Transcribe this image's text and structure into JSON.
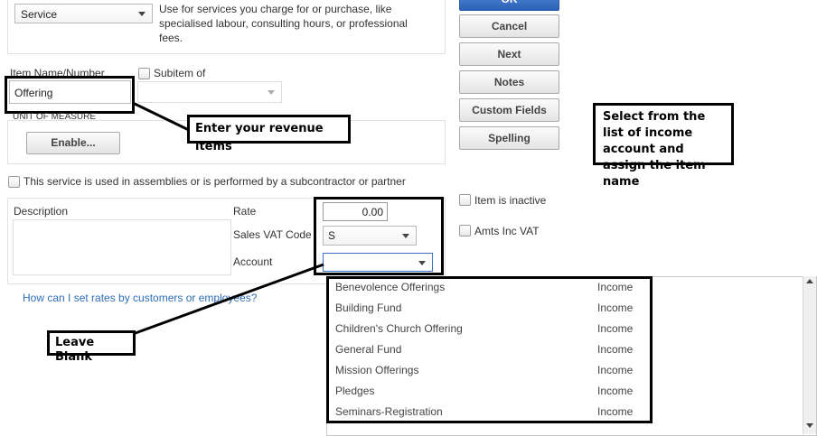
{
  "type": {
    "selected": "Service",
    "description": "Use for services you charge for or purchase, like specialised labour, consulting hours, or professional fees."
  },
  "item": {
    "name_label": "Item Name/Number",
    "name_value": "Offering",
    "subitem_label": "Subitem of"
  },
  "uom": {
    "label": "UNIT OF MEASURE",
    "enable_button": "Enable..."
  },
  "assembly_checkbox_label": "This service is used in assemblies or is performed by a subcontractor or partner",
  "details": {
    "description_label": "Description",
    "rate_label": "Rate",
    "rate_value": "0.00",
    "vat_label": "Sales VAT Code",
    "vat_value": "S",
    "account_label": "Account",
    "account_value": ""
  },
  "help_link": "How can I set rates by customers or employees?",
  "buttons": {
    "ok": "OK",
    "cancel": "Cancel",
    "next": "Next",
    "notes": "Notes",
    "custom_fields": "Custom Fields",
    "spelling": "Spelling"
  },
  "options": {
    "inactive_label": "Item is inactive",
    "amts_label": "Amts Inc VAT"
  },
  "account_list": [
    {
      "name": "Benevolence Offerings",
      "type": "Income"
    },
    {
      "name": "Building Fund",
      "type": "Income"
    },
    {
      "name": "Children's Church Offering",
      "type": "Income"
    },
    {
      "name": "General Fund",
      "type": "Income"
    },
    {
      "name": "Mission Offerings",
      "type": "Income"
    },
    {
      "name": "Pledges",
      "type": "Income"
    },
    {
      "name": "Seminars-Registration",
      "type": "Income"
    }
  ],
  "callouts": {
    "revenue": "Enter your revenue items",
    "select_account": "Select from the list of income account and assign the item name",
    "leave_blank": "Leave Blank"
  }
}
